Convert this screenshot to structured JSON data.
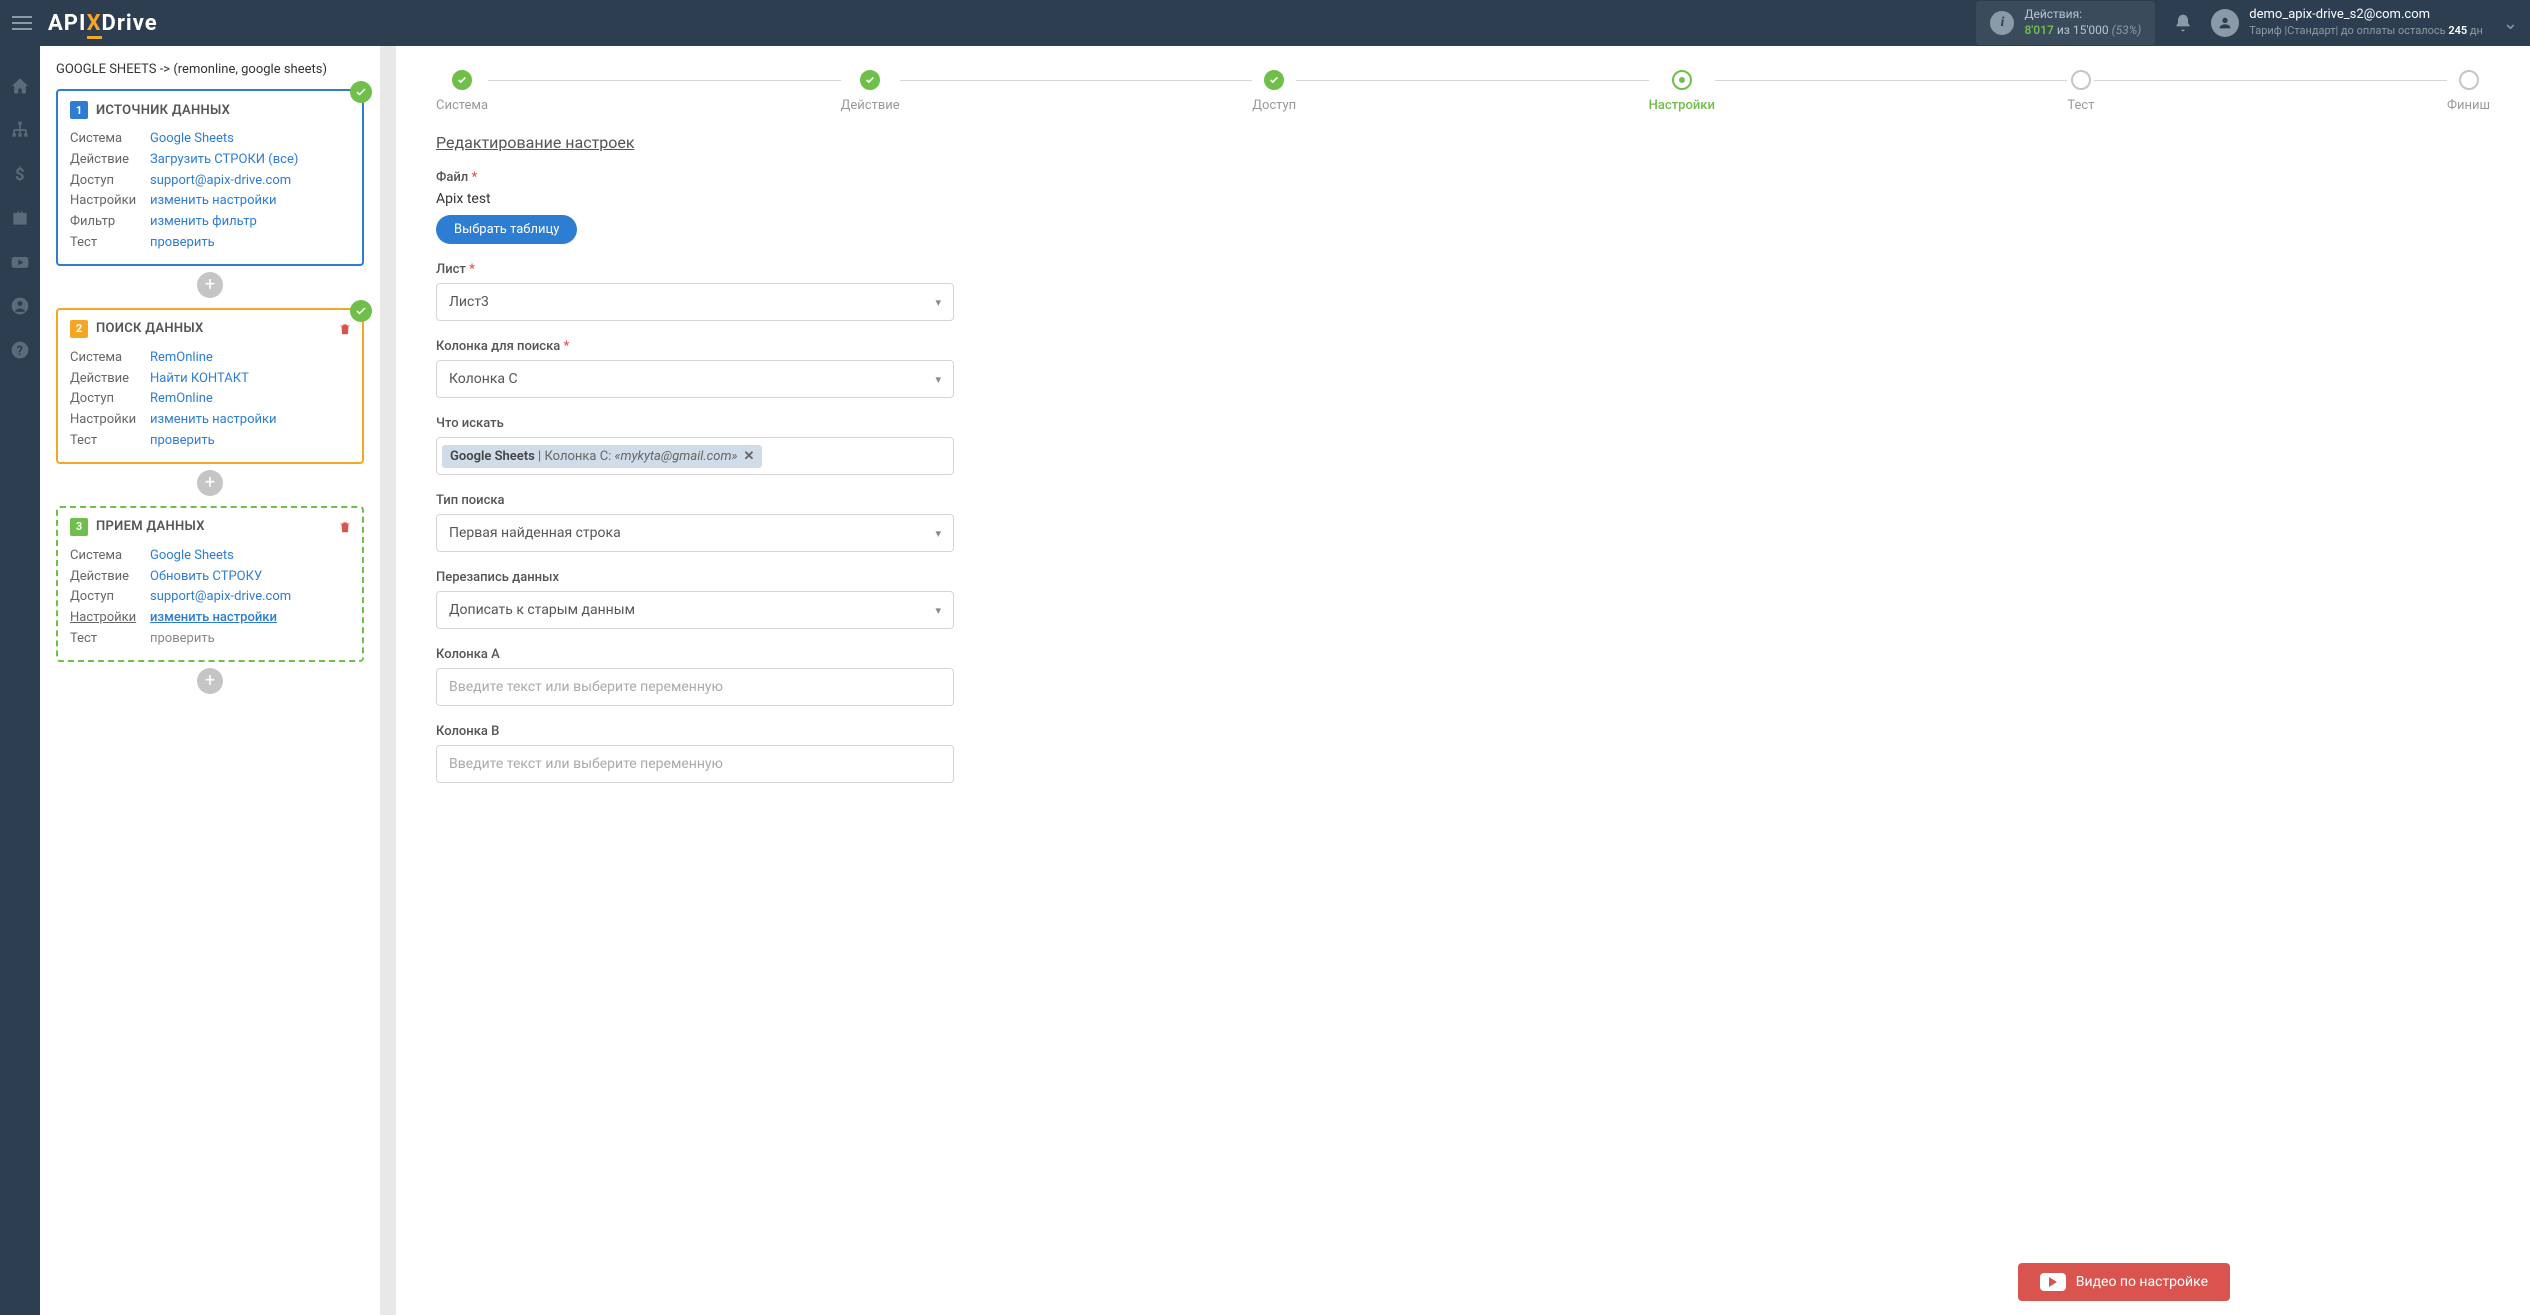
{
  "header": {
    "logo_pre": "API",
    "logo_x": "X",
    "logo_post": "Drive",
    "actions_label": "Действия:",
    "actions_used": "8'017",
    "actions_sep": "из",
    "actions_total": "15'000",
    "actions_pct": "(53%)",
    "user_email": "demo_apix-drive_s2@com.com",
    "tariff_pre": "Тариф |Стандарт| до оплаты осталось",
    "tariff_days": "245",
    "tariff_suffix": "дн"
  },
  "breadcrumb": "GOOGLE SHEETS -> (remonline, google sheets)",
  "cards": {
    "c1": {
      "title": "ИСТОЧНИК ДАННЫХ",
      "rows": {
        "system_l": "Система",
        "system_v": "Google Sheets",
        "action_l": "Действие",
        "action_v": "Загрузить СТРОКИ (все)",
        "access_l": "Доступ",
        "access_v": "support@apix-drive.com",
        "settings_l": "Настройки",
        "settings_v": "изменить настройки",
        "filter_l": "Фильтр",
        "filter_v": "изменить фильтр",
        "test_l": "Тест",
        "test_v": "проверить"
      }
    },
    "c2": {
      "title": "ПОИСК ДАННЫХ",
      "rows": {
        "system_l": "Система",
        "system_v": "RemOnline",
        "action_l": "Действие",
        "action_v": "Найти КОНТАКТ",
        "access_l": "Доступ",
        "access_v": "RemOnline",
        "settings_l": "Настройки",
        "settings_v": "изменить настройки",
        "test_l": "Тест",
        "test_v": "проверить"
      }
    },
    "c3": {
      "title": "ПРИЕМ ДАННЫХ",
      "rows": {
        "system_l": "Система",
        "system_v": "Google Sheets",
        "action_l": "Действие",
        "action_v": "Обновить СТРОКУ",
        "access_l": "Доступ",
        "access_v": "support@apix-drive.com",
        "settings_l": "Настройки",
        "settings_v": "изменить настройки",
        "test_l": "Тест",
        "test_v": "проверить"
      }
    }
  },
  "steps": {
    "s1": "Система",
    "s2": "Действие",
    "s3": "Доступ",
    "s4": "Настройки",
    "s5": "Тест",
    "s6": "Финиш"
  },
  "form": {
    "title": "Редактирование настроек",
    "file_label": "Файл",
    "file_value": "Apix test",
    "file_button": "Выбрать таблицу",
    "sheet_label": "Лист",
    "sheet_value": "Лист3",
    "searchcol_label": "Колонка для поиска",
    "searchcol_value": "Колонка C",
    "what_label": "Что искать",
    "tag_src": "Google Sheets",
    "tag_col": "| Колонка C:",
    "tag_em": "«mykyta@gmail.com»",
    "type_label": "Тип поиска",
    "type_value": "Первая найденная строка",
    "overwrite_label": "Перезапись данных",
    "overwrite_value": "Дописать к старым данным",
    "colA_label": "Колонка A",
    "colB_label": "Колонка B",
    "placeholder": "Введите текст или выберите переменную"
  },
  "video_btn": "Видео по настройке"
}
